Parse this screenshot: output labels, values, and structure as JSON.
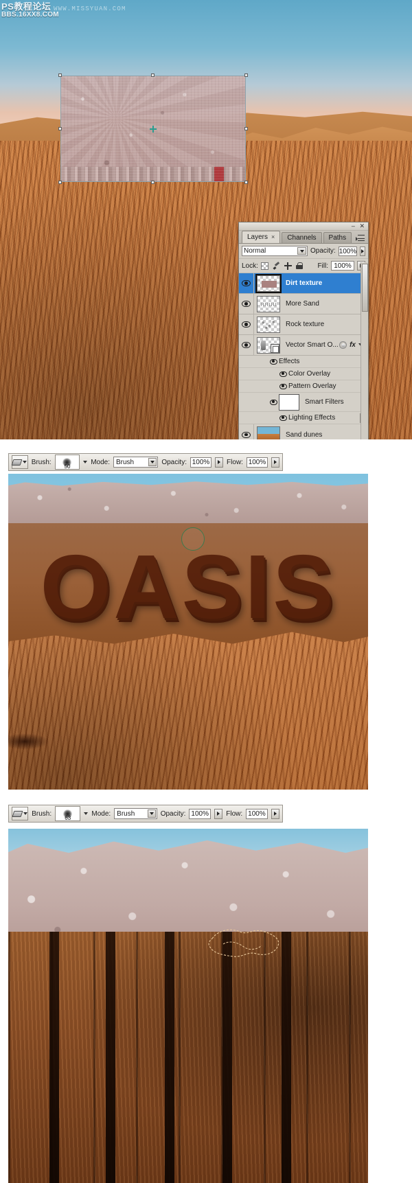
{
  "watermark": {
    "line1": "PS教程论坛",
    "line2": "BBS.16XX8.COM",
    "site": "WWW.MISSYUAN.COM"
  },
  "layers_panel": {
    "tabs": [
      {
        "label": "Layers",
        "active": true,
        "close": "×"
      },
      {
        "label": "Channels",
        "active": false
      },
      {
        "label": "Paths",
        "active": false
      }
    ],
    "window_buttons": {
      "minimize": "–",
      "close": "✕"
    },
    "blend_mode": "Normal",
    "opacity_label": "Opacity:",
    "opacity_value": "100%",
    "lock_label": "Lock:",
    "fill_label": "Fill:",
    "fill_value": "100%",
    "lock_icons": [
      "lock-transparent-pixels-icon",
      "lock-image-pixels-icon",
      "lock-position-icon",
      "lock-all-icon"
    ],
    "layers": [
      {
        "name": "Dirt texture",
        "selected": true,
        "thumb": "dirt",
        "visible": true
      },
      {
        "name": "More Sand",
        "selected": false,
        "thumb": "sand",
        "visible": true
      },
      {
        "name": "Rock texture",
        "selected": false,
        "thumb": "rock",
        "visible": true
      },
      {
        "name": "Vector Smart O...",
        "selected": false,
        "thumb": "smart",
        "visible": true,
        "right_icons": [
          "smart-object-icon",
          "fx-icon",
          "expand-triangle-icon"
        ]
      }
    ],
    "effects": {
      "label": "Effects",
      "items": [
        "Color Overlay",
        "Pattern Overlay"
      ]
    },
    "smart_filters": {
      "label": "Smart Filters",
      "items": [
        "Lighting Effects"
      ]
    },
    "bottom_layer": {
      "name": "Sand dunes",
      "visible": true,
      "thumb": "dunes"
    }
  },
  "brush_bar_1": {
    "tool": "eraser-tool",
    "brush_label": "Brush:",
    "brush_size": "50",
    "mode_label": "Mode:",
    "mode_value": "Brush",
    "opacity_label": "Opacity:",
    "opacity_value": "100%",
    "flow_label": "Flow:",
    "flow_value": "100%"
  },
  "brush_bar_2": {
    "tool": "eraser-tool",
    "brush_label": "Brush:",
    "brush_size": "63",
    "mode_label": "Mode:",
    "mode_value": "Brush",
    "opacity_label": "Opacity:",
    "opacity_value": "100%",
    "flow_label": "Flow:",
    "flow_value": "100%"
  },
  "canvas": {
    "oasis_text": "OASIS"
  }
}
